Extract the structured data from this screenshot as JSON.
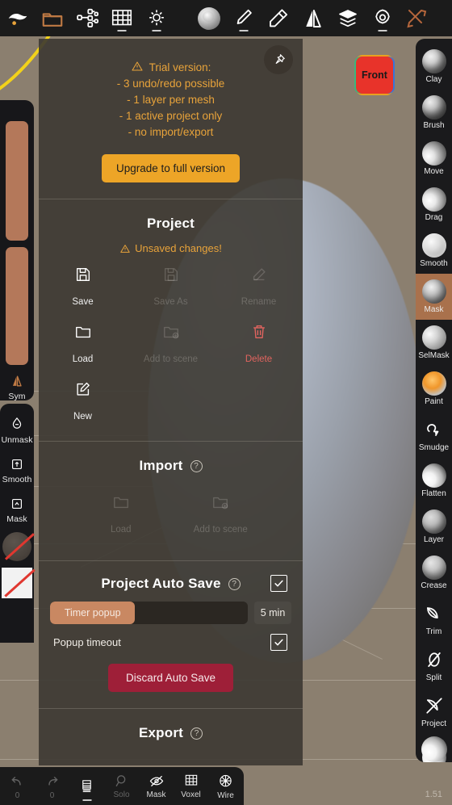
{
  "app": {
    "version": "1.51"
  },
  "topbar": {
    "items": [
      {
        "name": "scene-icon",
        "label": ""
      },
      {
        "name": "files-icon",
        "label": ""
      },
      {
        "name": "topology-icon",
        "label": ""
      },
      {
        "name": "grid-icon",
        "label": ""
      },
      {
        "name": "lighting-icon",
        "label": ""
      },
      {
        "name": "matcap-icon",
        "label": ""
      },
      {
        "name": "pen-pressure-icon",
        "label": ""
      },
      {
        "name": "stamp-icon",
        "label": ""
      },
      {
        "name": "symmetry-icon",
        "label": ""
      },
      {
        "name": "layers-icon",
        "label": ""
      },
      {
        "name": "settings-icon",
        "label": ""
      },
      {
        "name": "tools-icon",
        "label": ""
      }
    ]
  },
  "viewport": {
    "gizmo_label": "Front"
  },
  "left_rail": {
    "color_swatch_primary": "#b4785a",
    "color_swatch_secondary": "#b4785a",
    "symmetry_label": "Sym",
    "items": [
      {
        "icon": "unmask-icon",
        "label": "Unmask"
      },
      {
        "icon": "smooth-mask-icon",
        "label": "Smooth"
      },
      {
        "icon": "mask-icon",
        "label": "Mask"
      }
    ]
  },
  "right_rail": {
    "active_tool": "Mask",
    "tools": [
      {
        "label": "Clay",
        "icon": "clay-brush-icon"
      },
      {
        "label": "Brush",
        "icon": "brush-icon"
      },
      {
        "label": "Move",
        "icon": "move-icon"
      },
      {
        "label": "Drag",
        "icon": "drag-icon"
      },
      {
        "label": "Smooth",
        "icon": "smooth-icon"
      },
      {
        "label": "Mask",
        "icon": "mask-tool-icon"
      },
      {
        "label": "SelMask",
        "icon": "selmask-icon"
      },
      {
        "label": "Paint",
        "icon": "paint-icon"
      },
      {
        "label": "Smudge",
        "icon": "smudge-icon"
      },
      {
        "label": "Flatten",
        "icon": "flatten-icon"
      },
      {
        "label": "Layer",
        "icon": "layer-icon"
      },
      {
        "label": "Crease",
        "icon": "crease-icon"
      },
      {
        "label": "Trim",
        "icon": "trim-icon"
      },
      {
        "label": "Split",
        "icon": "split-icon"
      },
      {
        "label": "Project",
        "icon": "project-icon"
      }
    ]
  },
  "panel": {
    "pin_icon": "pin-icon",
    "trial": {
      "warning_icon": "warning-triangle-icon",
      "title": "Trial version:",
      "bullets": [
        "- 3 undo/redo possible",
        "- 1 layer per mesh",
        "- 1 active project only",
        "- no import/export"
      ],
      "upgrade_label": "Upgrade to full version",
      "accent_color": "#e8a33a",
      "button_color": "#eda527"
    },
    "project": {
      "title": "Project",
      "status_text": "Unsaved changes!",
      "status_icon": "warning-triangle-icon",
      "actions": [
        {
          "label": "Save",
          "icon": "floppy-disk-icon",
          "state": "enabled"
        },
        {
          "label": "Save As",
          "icon": "floppy-disk-icon",
          "state": "disabled"
        },
        {
          "label": "Rename",
          "icon": "rename-icon",
          "state": "disabled"
        },
        {
          "label": "Load",
          "icon": "folder-icon",
          "state": "enabled"
        },
        {
          "label": "Add to scene",
          "icon": "folder-add-icon",
          "state": "disabled"
        },
        {
          "label": "Delete",
          "icon": "trash-icon",
          "state": "danger"
        },
        {
          "label": "New",
          "icon": "new-doc-icon",
          "state": "enabled"
        }
      ]
    },
    "import": {
      "title": "Import",
      "help_icon": "help-icon",
      "actions": [
        {
          "label": "Load",
          "icon": "folder-icon",
          "state": "disabled"
        },
        {
          "label": "Add to scene",
          "icon": "folder-add-icon",
          "state": "disabled"
        }
      ]
    },
    "autosave": {
      "title": "Project Auto Save",
      "help_icon": "help-icon",
      "enabled": true,
      "timer_label": "Timer popup",
      "timer_value": "5 min",
      "timer_fill_percent": 43,
      "popup_timeout_label": "Popup timeout",
      "popup_timeout_enabled": true,
      "discard_label": "Discard Auto Save",
      "discard_color": "#9e1f38"
    },
    "export": {
      "title": "Export",
      "help_icon": "help-icon"
    }
  },
  "bottombar": {
    "items": [
      {
        "label": "0",
        "icon": "undo-icon",
        "state": "dim"
      },
      {
        "label": "0",
        "icon": "redo-icon",
        "state": "dim"
      },
      {
        "label": "",
        "icon": "multires-icon",
        "state": "enabled"
      },
      {
        "label": "Solo",
        "icon": "solo-icon",
        "state": "dim"
      },
      {
        "label": "Mask",
        "icon": "mask-visibility-icon",
        "state": "enabled"
      },
      {
        "label": "Voxel",
        "icon": "voxel-grid-icon",
        "state": "enabled"
      },
      {
        "label": "Wire",
        "icon": "wireframe-icon",
        "state": "enabled"
      }
    ]
  }
}
